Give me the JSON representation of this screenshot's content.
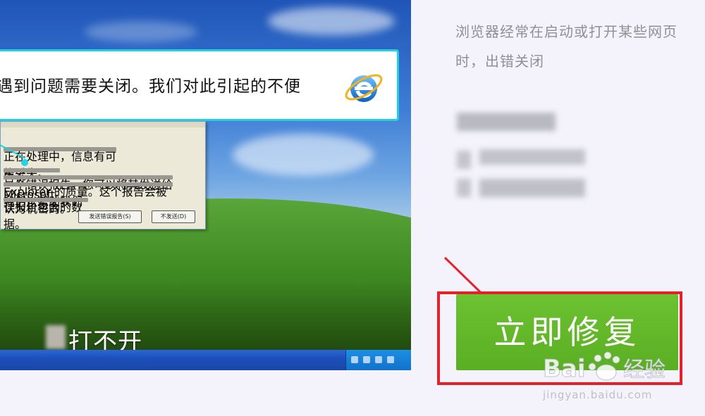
{
  "error_dialog": {
    "message": "遇到问题需要关闭。我们对此引起的不便",
    "small_dialog_lines": [
      "正在处理中，信息有可能丢失。",
      "告诉 Microsoft。",
      "一个错误报告，您可以将其发送给我们以帮助我们",
      "Explorer 的质量。这个报告会被认为机密的。",
      "误报告包含的数据。"
    ],
    "send_button": "发送错误报告(S)",
    "dont_send_button": "不发送(D)",
    "ie_logo": "internet-explorer-logo"
  },
  "caption": "打不开",
  "description": "浏览器经常在启动或打开某些网页时，出错关闭",
  "fix_button": "立即修复",
  "watermark": {
    "brand": "Bai经验",
    "url": "jingyan.baidu.com"
  },
  "colors": {
    "callout_border": "#1fd0e2",
    "fix_button": "#5aae22",
    "highlight_box": "#e5202a",
    "description_text": "#8f8f95"
  }
}
